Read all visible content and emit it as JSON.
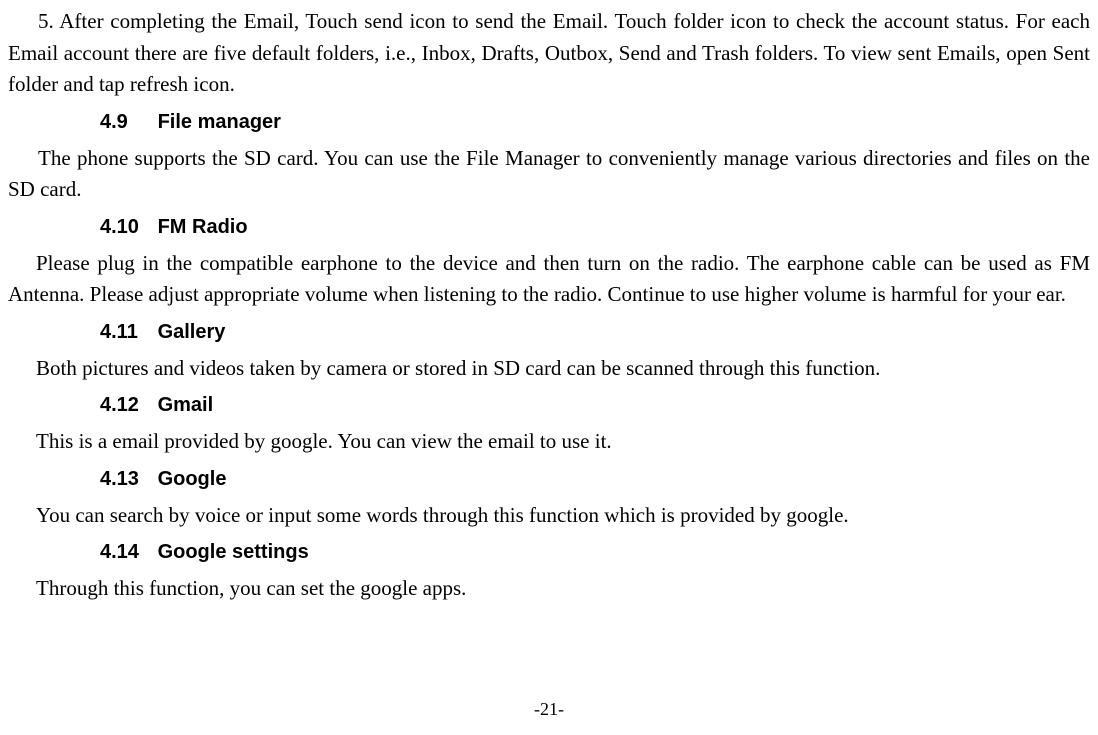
{
  "para5": "5.    After completing the Email, Touch send icon to send the Email. Touch folder icon to check the account status. For each Email account there are five default folders, i.e., Inbox, Drafts, Outbox, Send and Trash folders. To view sent Emails, open Sent folder and tap refresh icon.",
  "sections": {
    "s49": {
      "num": "4.9",
      "title": "File manager",
      "body": "The phone supports the SD card. You can use the File Manager to conveniently manage various directories and files on the SD card."
    },
    "s410": {
      "num": "4.10",
      "title": "FM Radio",
      "body": "Please plug in the compatible earphone to the device and then turn on the radio. The earphone cable can be used as FM Antenna. Please adjust appropriate volume when listening to the radio. Continue to use higher volume is harmful for your ear."
    },
    "s411": {
      "num": "4.11",
      "title": "Gallery",
      "body": "Both pictures and videos taken by camera or stored in SD card can be scanned through this function."
    },
    "s412": {
      "num": "4.12",
      "title": "Gmail",
      "body": "This is a email provided by google. You can view the email to use it."
    },
    "s413": {
      "num": "4.13",
      "title": "Google",
      "body": "You can search by voice or input some words through this function which is provided by google."
    },
    "s414": {
      "num": "4.14",
      "title": "Google settings",
      "body": "Through this function, you can set the google apps."
    }
  },
  "pageNumber": "-21-"
}
